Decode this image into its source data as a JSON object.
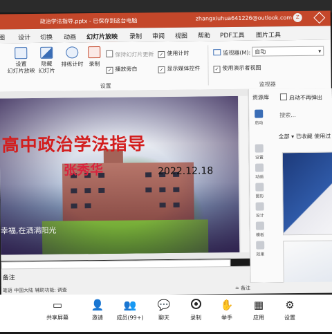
{
  "titlebar": {
    "doc_name": "政治学法指导.pptx - 已保存到这台电脑",
    "email": "zhangxiuhua641226@outlook.com",
    "avatar_letter": "Z"
  },
  "tabs": [
    "图",
    "设计",
    "切换",
    "动画",
    "幻灯片放映",
    "录制",
    "审阅",
    "视图",
    "帮助",
    "PDF工具",
    "图片工具"
  ],
  "ribbon": {
    "btn_rehearse": "设置\n幻灯片放映",
    "btn_hide": "隐藏\n幻灯片",
    "btn_timing": "排练计时",
    "btn_record": "录制",
    "chk_keep_updated": "保持幻灯片更新",
    "chk_narration": "播放旁白",
    "chk_use_timing": "使用计时",
    "chk_media_controls": "显示媒体控件",
    "group_setup": "设置",
    "monitor_label": "监视器(M):",
    "monitor_value": "自动",
    "chk_presenter_view": "使用演示者视图",
    "group_monitor": "监视器"
  },
  "slide": {
    "title": "高中政治学法指导",
    "author": "张秀华",
    "date": "2022.12.18",
    "caption": "幸福,在洒满阳光"
  },
  "notes_label": "备注",
  "status": {
    "left": "笔语   中国大陆   辅助功能: 调查",
    "right": "≐ 备注"
  },
  "resource_pane": {
    "title": "资源库",
    "checkbox": "启动不再弹出",
    "search_placeholder": "搜索...",
    "filter": "全部 ▾    已收藏    使用过",
    "side_items": [
      "启动",
      "设置",
      "动画",
      "图形",
      "设计",
      "模板",
      "效果"
    ]
  },
  "meeting_bar": {
    "share": "共享屏幕",
    "invite": "邀请",
    "members": "成员(99+)",
    "chat": "聊天",
    "record": "录制",
    "hand": "举手",
    "apps": "应用",
    "settings": "设置"
  },
  "colors": {
    "accent": "#c4472a",
    "title_red": "#d31d1d"
  }
}
